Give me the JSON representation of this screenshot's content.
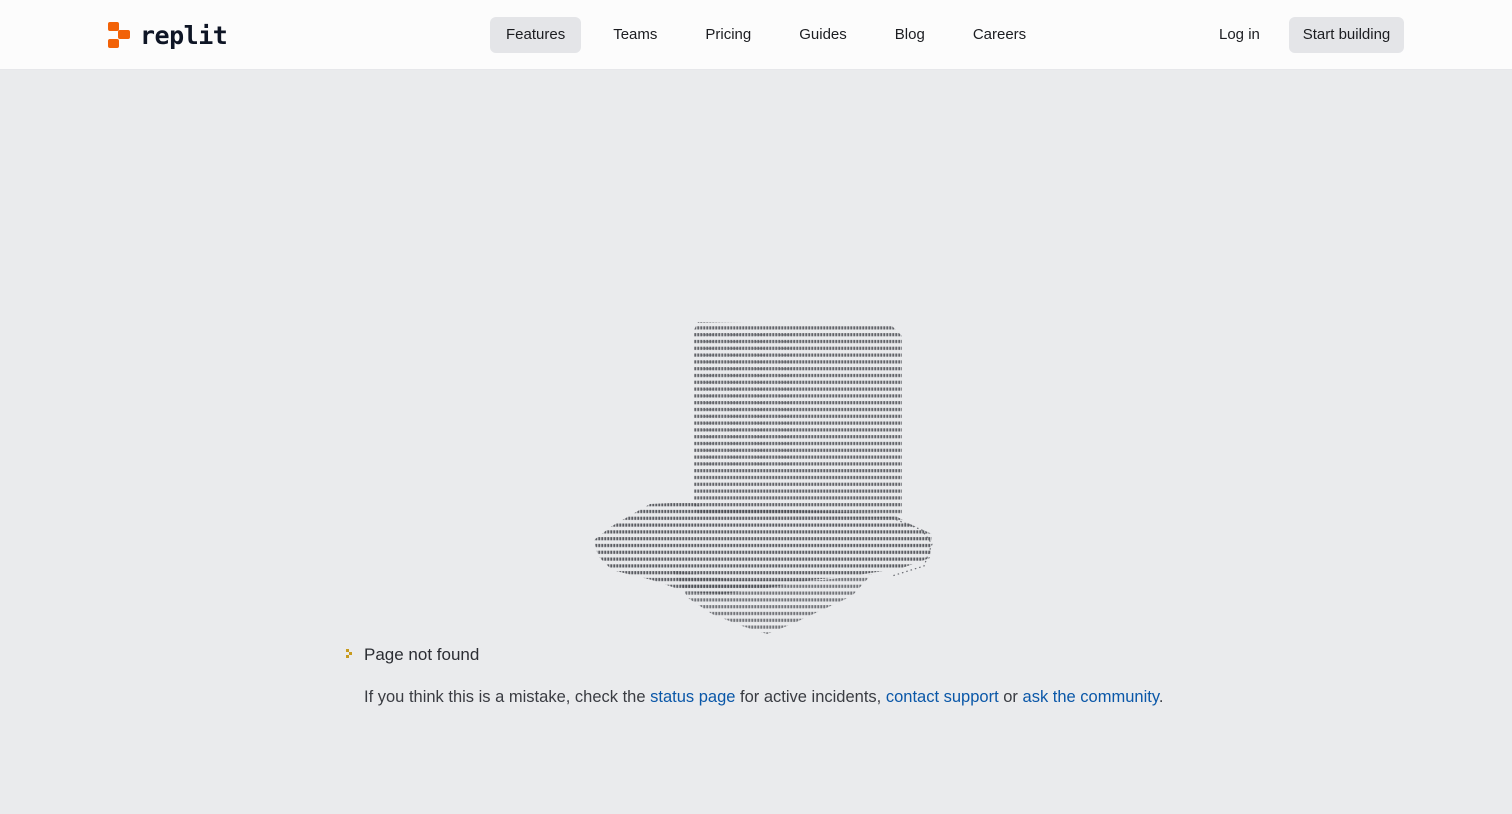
{
  "header": {
    "logo_text": "replit",
    "brand_color": "#f26207",
    "nav": [
      {
        "label": "Features",
        "active": true
      },
      {
        "label": "Teams",
        "active": false
      },
      {
        "label": "Pricing",
        "active": false
      },
      {
        "label": "Guides",
        "active": false
      },
      {
        "label": "Blog",
        "active": false
      },
      {
        "label": "Careers",
        "active": false
      }
    ],
    "login_label": "Log in",
    "cta_label": "Start building"
  },
  "main": {
    "illustration": "ascii-art-top-hat-icon",
    "error_title": "Page not found",
    "desc_prefix": "If you think this is a mistake, check the ",
    "status_link": "status page",
    "desc_mid1": " for active incidents, ",
    "support_link": "contact support",
    "desc_mid2": " or ",
    "community_link": "ask the community",
    "desc_suffix": ".",
    "link_color": "#0a57a8",
    "accent_icon_color": "#c89b1e"
  }
}
